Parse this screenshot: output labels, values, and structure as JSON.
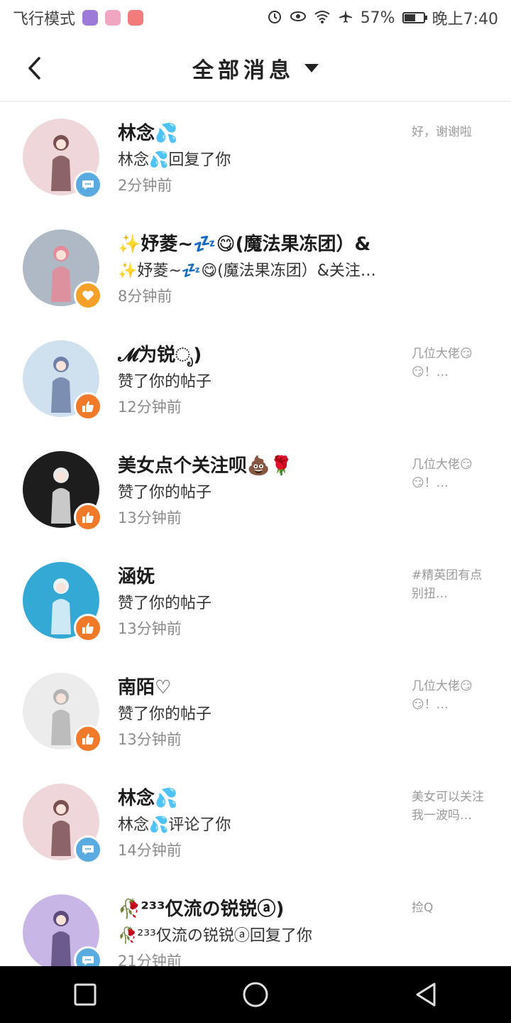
{
  "status_bar": {
    "left_text": "飞行模式",
    "battery": "57%",
    "battery_level": 0.57,
    "time": "晚上7:40",
    "icons": [
      "alarm-icon",
      "eye-icon",
      "wifi-icon",
      "airplane-icon",
      "battery-icon"
    ],
    "app_icons": [
      {
        "name": "app-icon-1",
        "color": "#9b7ad8"
      },
      {
        "name": "app-icon-2",
        "color": "#f0a6c0"
      },
      {
        "name": "app-icon-3",
        "color": "#f27c7c"
      }
    ]
  },
  "header": {
    "title": "全部消息"
  },
  "messages": [
    {
      "name": "林念💦",
      "action": "林念💦回复了你",
      "time": "2分钟前",
      "preview": "好，谢谢啦",
      "badge": "comment",
      "avatar_bg": "#efd6da",
      "avatar_fg": "#7a4f52"
    },
    {
      "name": "✨妤菱~💤😋(魔法果冻团）&",
      "action": "✨妤菱~💤😋(魔法果冻团）&关注…",
      "time": "8分钟前",
      "preview": "",
      "badge": "heart",
      "avatar_bg": "#aeb9c5",
      "avatar_fg": "#e58a98"
    },
    {
      "name": "𝓜为锐ೃ)",
      "action": "赞了你的帖子",
      "time": "12分钟前",
      "preview": "几位大佬😏😏！…",
      "badge": "like",
      "avatar_bg": "#cfe0ef",
      "avatar_fg": "#6f7fa8"
    },
    {
      "name": "美女点个关注呗💩🌹",
      "action": "赞了你的帖子",
      "time": "13分钟前",
      "preview": "几位大佬😏😏！…",
      "badge": "like",
      "avatar_bg": "#1d1d1d",
      "avatar_fg": "#e8e8e8"
    },
    {
      "name": "涵妩",
      "action": "赞了你的帖子",
      "time": "13分钟前",
      "preview": "#精英团有点别扭…",
      "badge": "like",
      "avatar_bg": "#35a9d6",
      "avatar_fg": "#e9f4fb"
    },
    {
      "name": "南陌♡",
      "action": "赞了你的帖子",
      "time": "13分钟前",
      "preview": "几位大佬😏😏！…",
      "badge": "like",
      "avatar_bg": "#ececec",
      "avatar_fg": "#b4b4b4"
    },
    {
      "name": "林念💦",
      "action": "林念💦评论了你",
      "time": "14分钟前",
      "preview": "美女可以关注我一波吗…",
      "badge": "comment",
      "avatar_bg": "#efd6da",
      "avatar_fg": "#7a4f52"
    },
    {
      "name": "🥀²³³仅流の锐锐ⓐ)",
      "action": "🥀²³³仅流の锐锐ⓐ回复了你",
      "time": "21分钟前",
      "preview": "捡Q",
      "badge": "comment",
      "avatar_bg": "#c8b6e6",
      "avatar_fg": "#5b4a7a"
    }
  ],
  "badge_colors": {
    "comment": "#5aace0",
    "heart": "#f4a12a",
    "like": "#f07a2a"
  },
  "nav_bar": {
    "buttons": [
      "recents-button",
      "home-button",
      "back-button"
    ]
  }
}
